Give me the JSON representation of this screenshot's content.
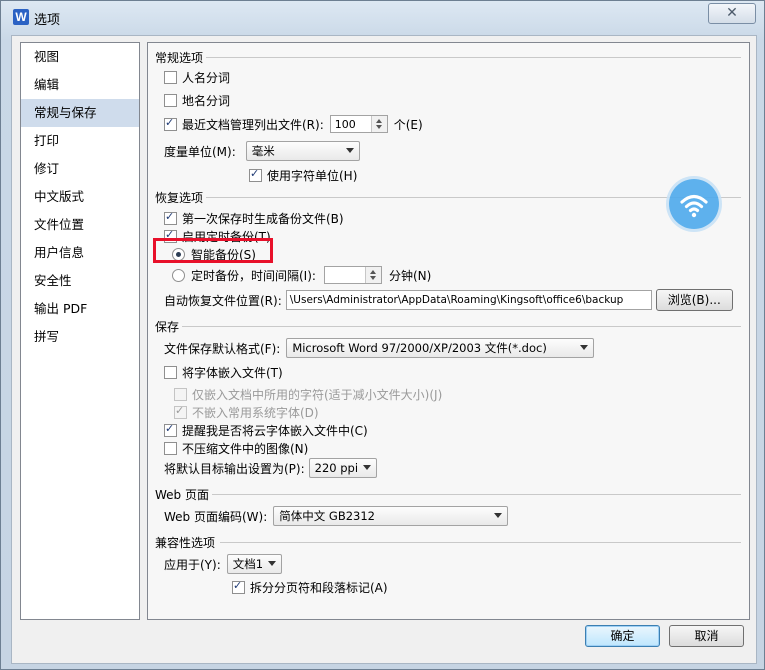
{
  "window": {
    "title": "选项",
    "app_icon_letter": "W",
    "close_glyph": "✕"
  },
  "sidebar": {
    "items": [
      {
        "label": "视图"
      },
      {
        "label": "编辑"
      },
      {
        "label": "常规与保存"
      },
      {
        "label": "打印"
      },
      {
        "label": "修订"
      },
      {
        "label": "中文版式"
      },
      {
        "label": "文件位置"
      },
      {
        "label": "用户信息"
      },
      {
        "label": "安全性"
      },
      {
        "label": "输出 PDF"
      },
      {
        "label": "拼写"
      }
    ],
    "selected": "常规与保存"
  },
  "general": {
    "section_title": "常规选项",
    "person_name_label": "人名分词",
    "person_name_checked": false,
    "place_name_label": "地名分词",
    "place_name_checked": false,
    "recent_files_label": "最近文档管理列出文件(R):",
    "recent_files_checked": true,
    "recent_files_value": "100",
    "recent_files_unit": "个(E)",
    "measure_label": "度量单位(M):",
    "measure_value": "毫米",
    "char_unit_label": "使用字符单位(H)",
    "char_unit_checked": true
  },
  "recovery": {
    "section_title": "恢复选项",
    "first_save_label": "第一次保存时生成备份文件(B)",
    "first_save_checked": true,
    "timed_backup_label": "启用定时备份(T)",
    "timed_backup_checked": true,
    "smart_backup_label": "智能备份(S)",
    "smart_backup_selected": true,
    "interval_label": "定时备份，时间间隔(I):",
    "interval_value": "",
    "interval_unit": "分钟(N)",
    "location_label": "自动恢复文件位置(R):",
    "location_value": "\\Users\\Administrator\\AppData\\Roaming\\Kingsoft\\office6\\backup",
    "browse_label": "浏览(B)..."
  },
  "save": {
    "section_title": "保存",
    "default_format_label": "文件保存默认格式(F):",
    "default_format_value": "Microsoft Word 97/2000/XP/2003 文件(*.doc)",
    "embed_fonts_label": "将字体嵌入文件(T)",
    "embed_fonts_checked": false,
    "embed_used_only_label": "仅嵌入文档中所用的字符(适于减小文件大小)(J)",
    "embed_used_only_checked": false,
    "no_common_fonts_label": "不嵌入常用系统字体(D)",
    "no_common_fonts_checked": true,
    "remind_cloud_label": "提醒我是否将云字体嵌入文件中(C)",
    "remind_cloud_checked": true,
    "no_compress_label": "不压缩文件中的图像(N)",
    "no_compress_checked": false,
    "output_label": "将默认目标输出设置为(P):",
    "output_value": "220 ppi"
  },
  "web": {
    "section_title": "Web 页面",
    "encoding_label": "Web 页面编码(W):",
    "encoding_value": "简体中文 GB2312"
  },
  "compat": {
    "section_title": "兼容性选项",
    "apply_label": "应用于(Y):",
    "apply_value": "文档1",
    "split_label": "拆分分页符和段落标记(A)",
    "split_checked": true
  },
  "footer": {
    "ok_label": "确定",
    "cancel_label": "取消"
  },
  "overlay": {
    "wifi_icon": "wifi-icon",
    "highlight_color": "#e8102a"
  }
}
